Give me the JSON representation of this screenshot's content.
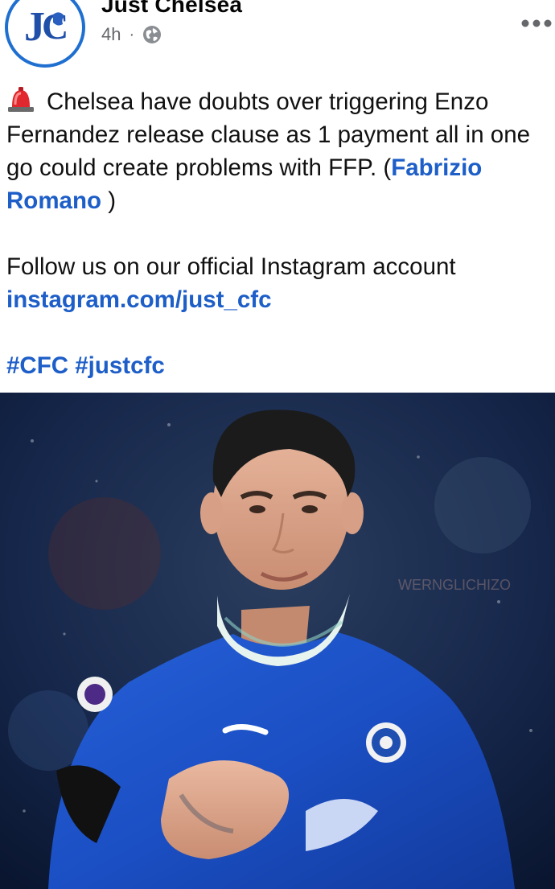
{
  "header": {
    "page_name": "Just Chelsea",
    "timestamp": "4h",
    "separator": "·",
    "privacy_icon": "globe-icon",
    "more_icon": "more-horizontal-icon",
    "avatar_logo_text": "JUST CHELSEA"
  },
  "post": {
    "emoji_icon": "siren-emoji",
    "line1_text": "Chelsea have doubts over triggering Enzo Fernandez release clause as 1 payment all in one go could create problems with FFP. (",
    "mention": "Fabrizio Romano",
    "line1_close": " )",
    "follow_text": "Follow us on our official Instagram account",
    "instagram_link": "instagram.com/just_cfc",
    "hashtag_1": "#CFC",
    "hashtag_2": "#justcfc"
  },
  "photo": {
    "watermark": "WERNGLICHIZO",
    "subject": "player-photo"
  },
  "colors": {
    "link": "#1d5ec8",
    "avatar_ring": "#1f6fd1",
    "kit_blue": "#1b4fc4"
  }
}
